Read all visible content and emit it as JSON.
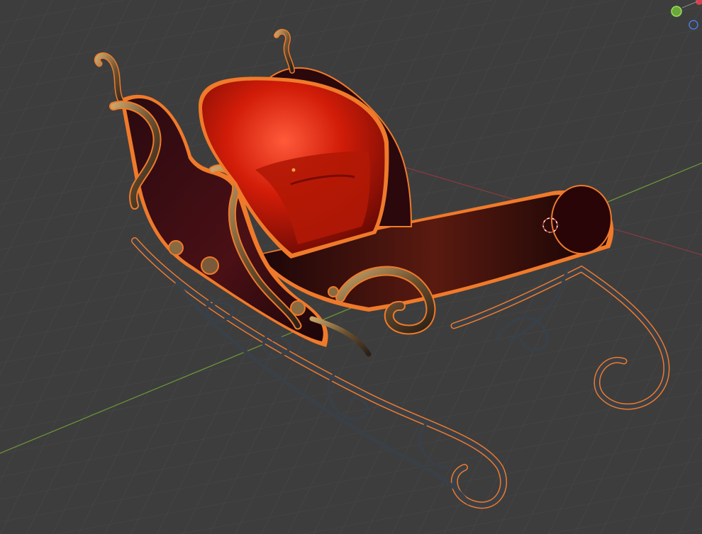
{
  "viewport": {
    "background": "#3d3d3d",
    "grid_color": "#4a4a4a",
    "x_axis_color": "#a34a4f",
    "y_axis_color": "#6f9a3a",
    "selection_outline": "#f07a2a"
  },
  "sleigh": {
    "seat_color": "#c81a0a",
    "body_color": "#3a0d12",
    "ornament_color": "#9c7a4a",
    "runner_color": "#3a4048"
  },
  "gizmo": {
    "y_axis_color": "#7fbf3f",
    "z_axis_color": "#3f6fcf",
    "x_axis_color": "#e04050"
  },
  "cursor": {
    "icon": "3d-cursor-icon"
  },
  "origin": {
    "icon": "object-origin-icon"
  }
}
